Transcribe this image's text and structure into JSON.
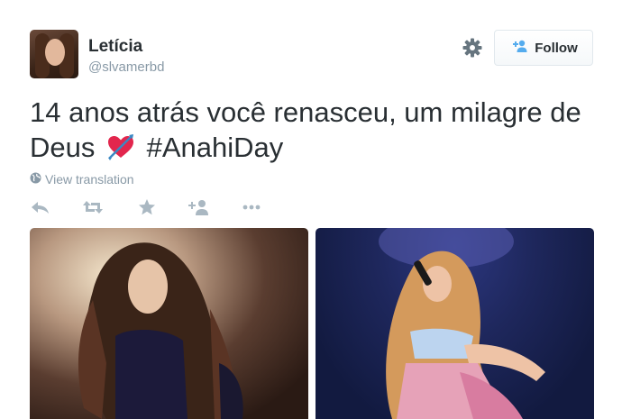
{
  "user": {
    "fullname": "Letícia",
    "username": "@slvamerbd"
  },
  "follow_button": {
    "label": "Follow"
  },
  "tweet": {
    "text_before_emoji": "14 anos atrás você renasceu, um milagre de Deus",
    "emoji": "heart-with-arrow-emoji",
    "hashtag": "#AnahiDay"
  },
  "translation": {
    "label": "View translation"
  },
  "actions": [
    "reply-icon",
    "retweet-icon",
    "favorite-icon",
    "follow-icon",
    "more-icon"
  ],
  "colors": {
    "text": "#292f33",
    "muted": "#8899a6",
    "accent": "#55acee",
    "heart": "#e2264d"
  }
}
